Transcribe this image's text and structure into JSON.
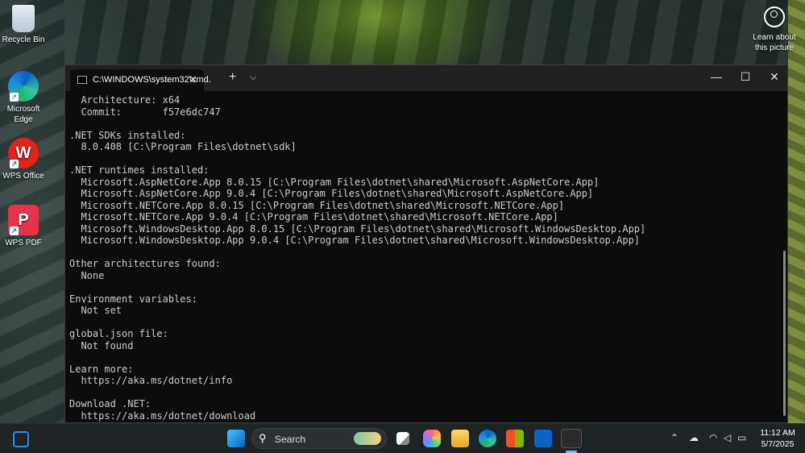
{
  "desktop": {
    "icons": [
      {
        "label": "Recycle Bin"
      },
      {
        "label": "Microsoft Edge"
      },
      {
        "label": "WPS Office",
        "glyph": "W"
      },
      {
        "label": "WPS PDF",
        "glyph": "P"
      }
    ],
    "learn_about": "Learn about this picture"
  },
  "terminal": {
    "tab_title": "C:\\WINDOWS\\system32\\cmd.",
    "tab_close": "✕",
    "new_tab": "+",
    "dropdown": "⌵",
    "minimize": "—",
    "maximize": "☐",
    "close": "✕",
    "console_lines": [
      "  Architecture: x64",
      "  Commit:       f57e6dc747",
      "",
      ".NET SDKs installed:",
      "  8.0.408 [C:\\Program Files\\dotnet\\sdk]",
      "",
      ".NET runtimes installed:",
      "  Microsoft.AspNetCore.App 8.0.15 [C:\\Program Files\\dotnet\\shared\\Microsoft.AspNetCore.App]",
      "  Microsoft.AspNetCore.App 9.0.4 [C:\\Program Files\\dotnet\\shared\\Microsoft.AspNetCore.App]",
      "  Microsoft.NETCore.App 8.0.15 [C:\\Program Files\\dotnet\\shared\\Microsoft.NETCore.App]",
      "  Microsoft.NETCore.App 9.0.4 [C:\\Program Files\\dotnet\\shared\\Microsoft.NETCore.App]",
      "  Microsoft.WindowsDesktop.App 8.0.15 [C:\\Program Files\\dotnet\\shared\\Microsoft.WindowsDesktop.App]",
      "  Microsoft.WindowsDesktop.App 9.0.4 [C:\\Program Files\\dotnet\\shared\\Microsoft.WindowsDesktop.App]",
      "",
      "Other architectures found:",
      "  None",
      "",
      "Environment variables:",
      "  Not set",
      "",
      "global.json file:",
      "  Not found",
      "",
      "Learn more:",
      "  https://aka.ms/dotnet/info",
      "",
      "Download .NET:",
      "  https://aka.ms/dotnet/download"
    ]
  },
  "taskbar": {
    "search_placeholder": "Search",
    "tray": {
      "chevron": "⌃",
      "time": "11:12 AM",
      "date": "5/7/2025"
    }
  },
  "icons": [
    "recycle-bin-icon",
    "edge-icon",
    "wps-office-icon",
    "wps-pdf-icon",
    "learn-about-icon",
    "widgets-icon",
    "start-icon",
    "search-icon",
    "task-view-icon",
    "copilot-icon",
    "file-explorer-icon",
    "store-icon",
    "outlook-icon",
    "terminal-icon",
    "onedrive-icon",
    "wifi-icon",
    "volume-icon"
  ]
}
